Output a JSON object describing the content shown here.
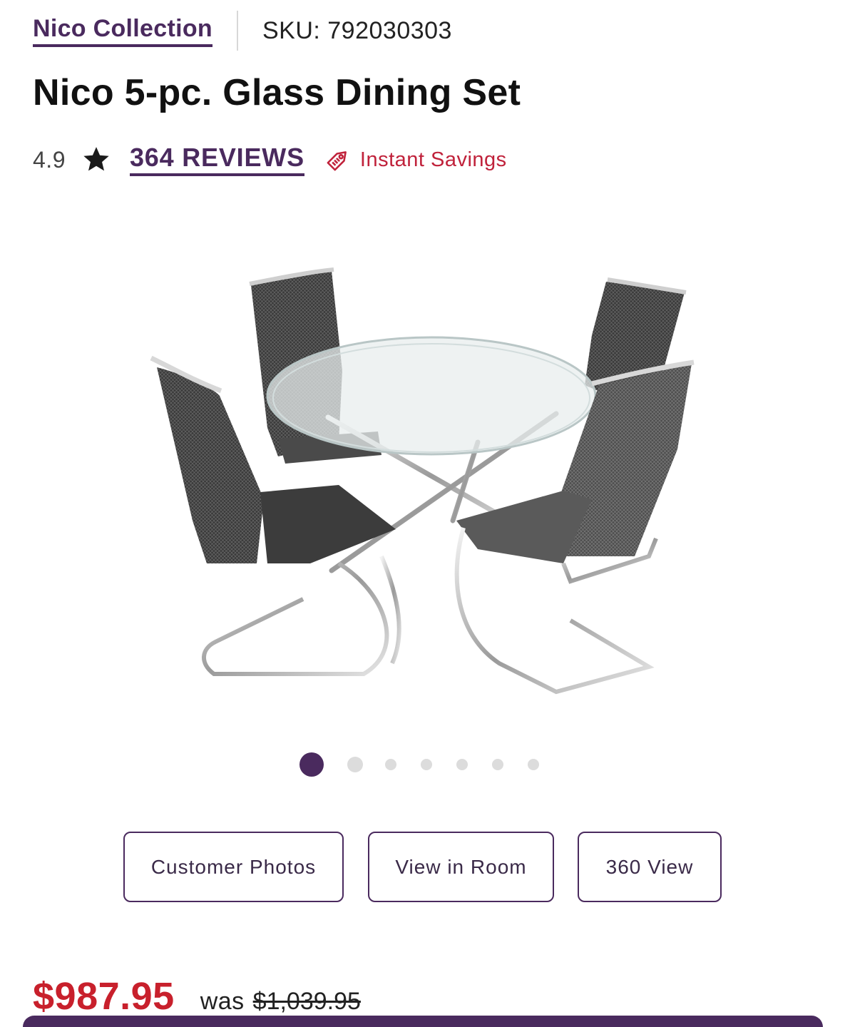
{
  "header": {
    "collection_link": "Nico Collection",
    "sku": "SKU: 792030303"
  },
  "product": {
    "title": "Nico 5-pc. Glass Dining Set",
    "rating": "4.9",
    "reviews_link": "364 REVIEWS",
    "savings_label": "Instant Savings",
    "image_icon": "dining-set-photo"
  },
  "carousel": {
    "total_slides": 7,
    "active_index": 0
  },
  "view_buttons": {
    "customer_photos": "Customer Photos",
    "view_in_room": "View in Room",
    "view_360": "360 View"
  },
  "pricing": {
    "current_price": "$987.95",
    "was_label": "was",
    "was_price": "$1,039.95"
  },
  "colors": {
    "brand_purple": "#4a2a5e",
    "sale_red": "#c8202c",
    "savings_red": "#c0223b"
  }
}
